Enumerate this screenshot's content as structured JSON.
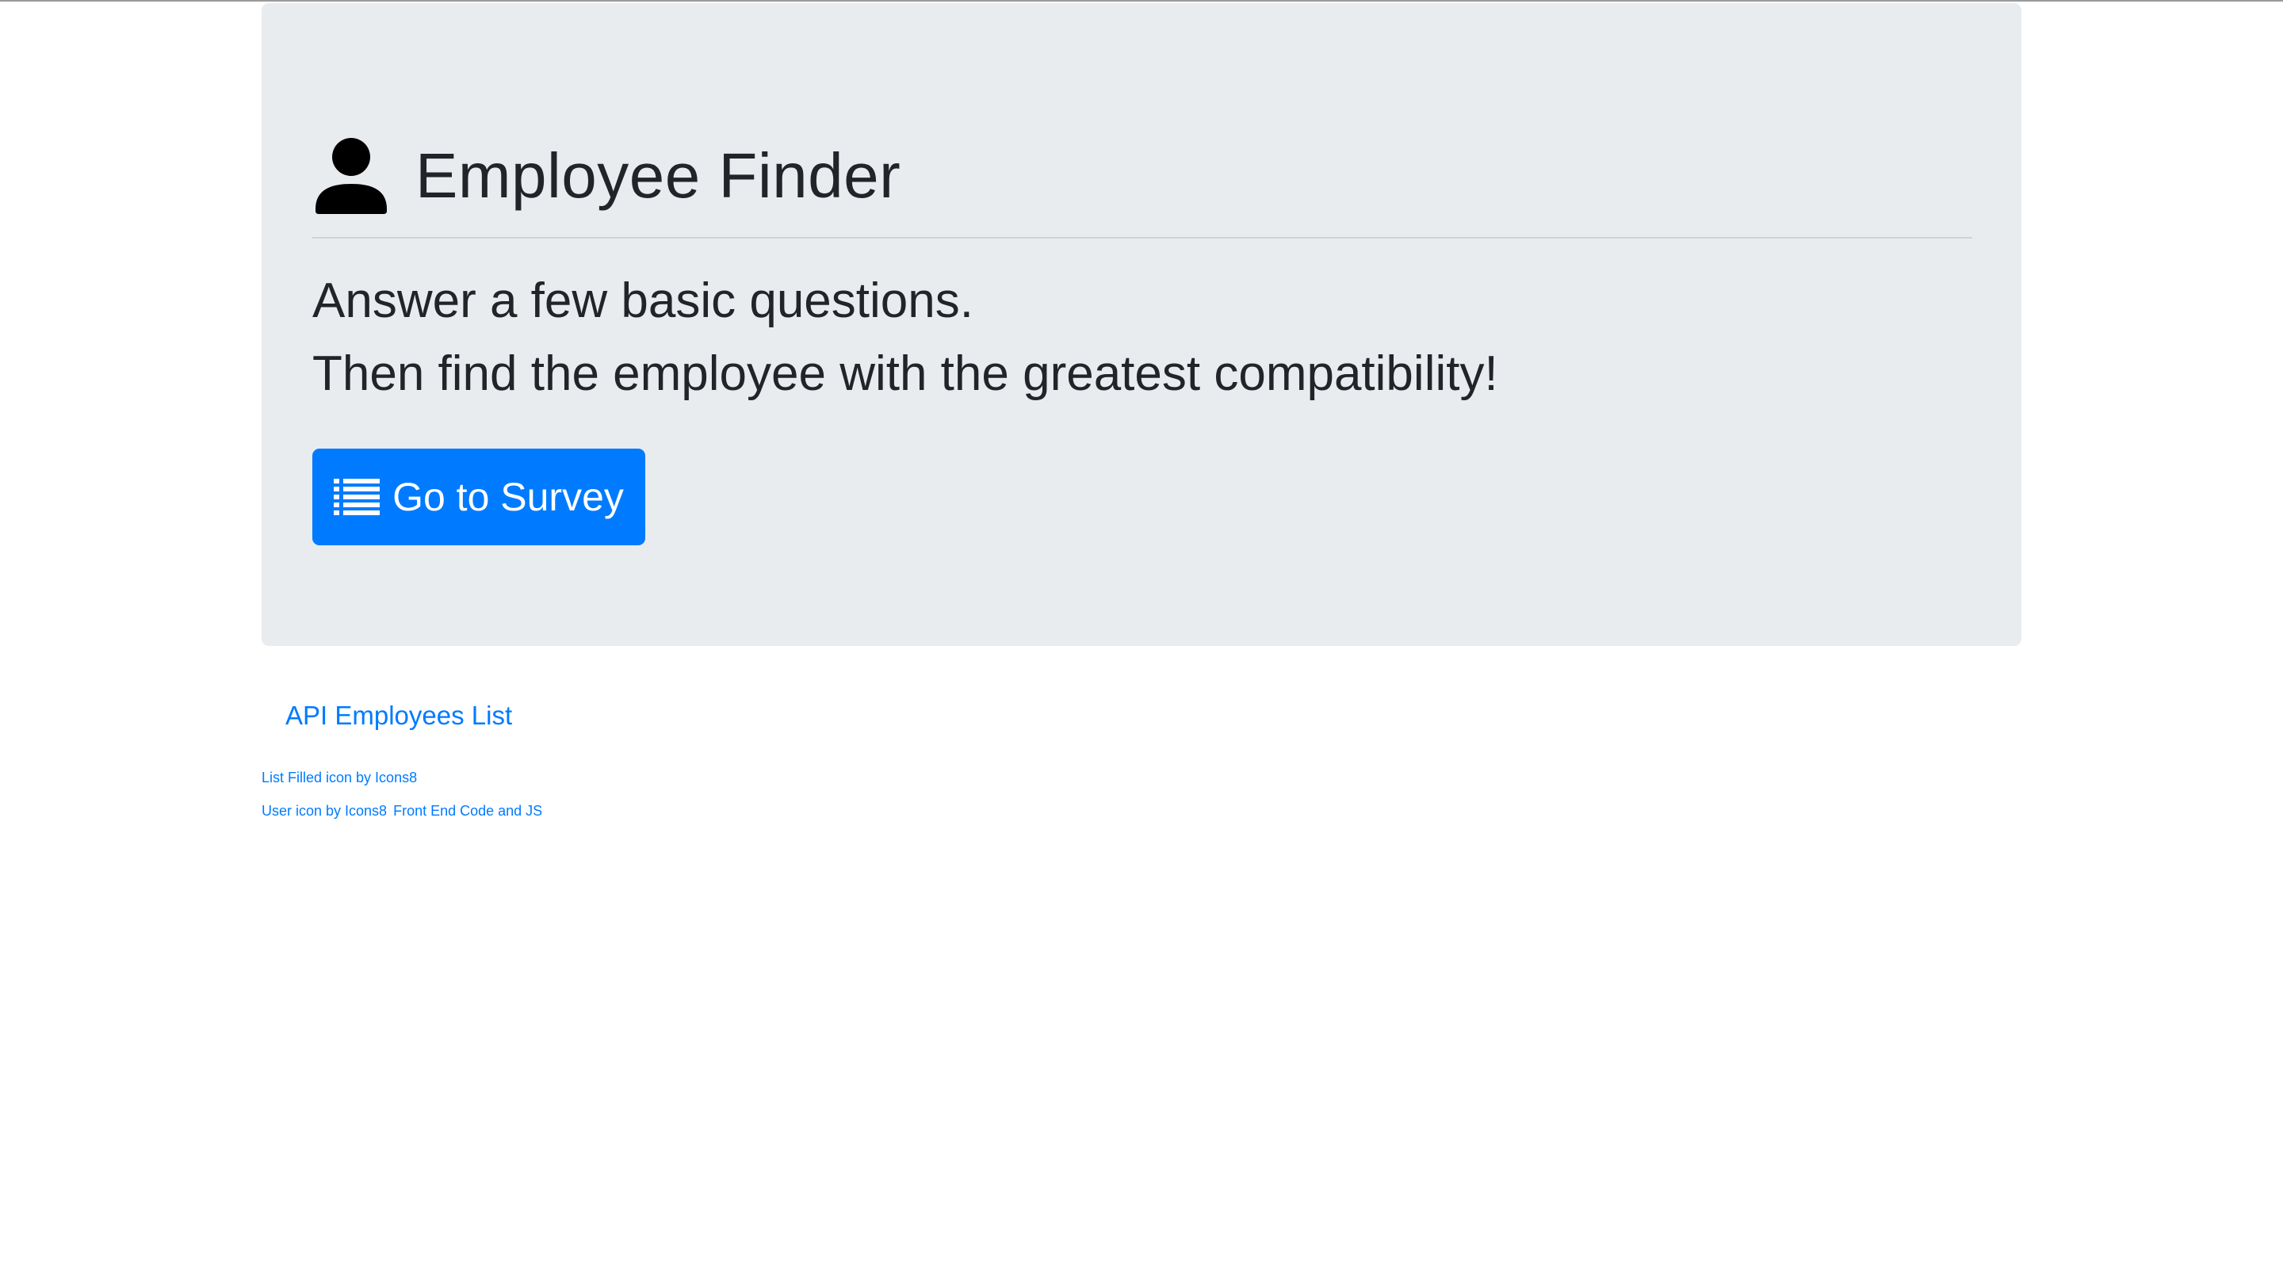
{
  "jumbotron": {
    "title": "Employee Finder",
    "user_icon": "user-icon",
    "lead_line_1": "Answer a few basic questions.",
    "lead_line_2": "Then find the employee with the greatest compatibility!",
    "survey_button": {
      "icon": "list-icon",
      "label": "Go to Survey"
    }
  },
  "links": {
    "api_employees": "API Employees List"
  },
  "credits": {
    "list_icon_credit": "List Filled icon by Icons8",
    "user_icon_credit": "User icon by Icons8",
    "source_link": "Front End Code and JS"
  },
  "colors": {
    "accent": "#007bff",
    "jumbotron_bg": "#e9ecef",
    "text": "#212529"
  }
}
